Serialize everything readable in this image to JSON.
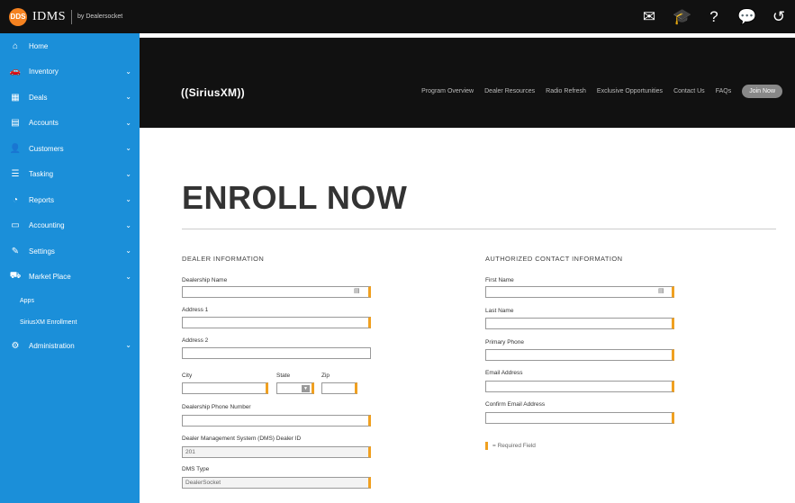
{
  "topbar": {
    "brand_logo": "DDS",
    "brand_name": "IDMS",
    "brand_sub": "by Dealersocket",
    "icons": [
      "mail-icon",
      "graduation-cap-icon",
      "help-icon",
      "chat-icon",
      "history-icon"
    ],
    "icon_glyphs": [
      "✉",
      "🎓",
      "?",
      "💬",
      "↺"
    ]
  },
  "sidebar": {
    "items": [
      {
        "label": "Home",
        "icon": "⌂",
        "chevron": ""
      },
      {
        "label": "Inventory",
        "icon": "🚗",
        "chevron": "⌄"
      },
      {
        "label": "Deals",
        "icon": "▦",
        "chevron": "⌄"
      },
      {
        "label": "Accounts",
        "icon": "▤",
        "chevron": "⌄"
      },
      {
        "label": "Customers",
        "icon": "👤",
        "chevron": "⌄"
      },
      {
        "label": "Tasking",
        "icon": "☰",
        "chevron": "⌄"
      },
      {
        "label": "Reports",
        "icon": "◔",
        "chevron": "⌄"
      },
      {
        "label": "Accounting",
        "icon": "▭",
        "chevron": "⌄"
      },
      {
        "label": "Settings",
        "icon": "✎",
        "chevron": "⌄"
      },
      {
        "label": "Market Place",
        "icon": "⛟",
        "chevron": "⌄"
      }
    ],
    "subitems": [
      "Apps",
      "SiriusXM Enrollment"
    ],
    "admin": {
      "label": "Administration",
      "icon": "⚙",
      "chevron": "⌄"
    }
  },
  "sirius": {
    "logo": "((SiriusXM))",
    "nav": [
      "Program Overview",
      "Dealer Resources",
      "Radio Refresh",
      "Exclusive Opportunities",
      "Contact Us",
      "FAQs"
    ],
    "join": "Join Now"
  },
  "page": {
    "headline": "ENROLL NOW",
    "dealer_title": "DEALER INFORMATION",
    "contact_title": "AUTHORIZED CONTACT INFORMATION",
    "required_note": "= Required Field"
  },
  "dealer_fields": {
    "dealership_name": {
      "label": "Dealership Name",
      "value": ""
    },
    "address1": {
      "label": "Address 1",
      "value": ""
    },
    "address2": {
      "label": "Address 2",
      "value": ""
    },
    "city": {
      "label": "City",
      "value": ""
    },
    "state": {
      "label": "State",
      "value": ""
    },
    "zip": {
      "label": "Zip",
      "value": ""
    },
    "phone": {
      "label": "Dealership Phone Number",
      "value": ""
    },
    "dms_id": {
      "label": "Dealer Management System (DMS) Dealer ID",
      "value": "201"
    },
    "dms_type": {
      "label": "DMS Type",
      "value": "DealerSocket"
    }
  },
  "contact_fields": {
    "first_name": {
      "label": "First Name",
      "value": ""
    },
    "last_name": {
      "label": "Last Name",
      "value": ""
    },
    "primary_phone": {
      "label": "Primary Phone",
      "value": ""
    },
    "email": {
      "label": "Email Address",
      "value": ""
    },
    "confirm_email": {
      "label": "Confirm Email Address",
      "value": ""
    }
  }
}
